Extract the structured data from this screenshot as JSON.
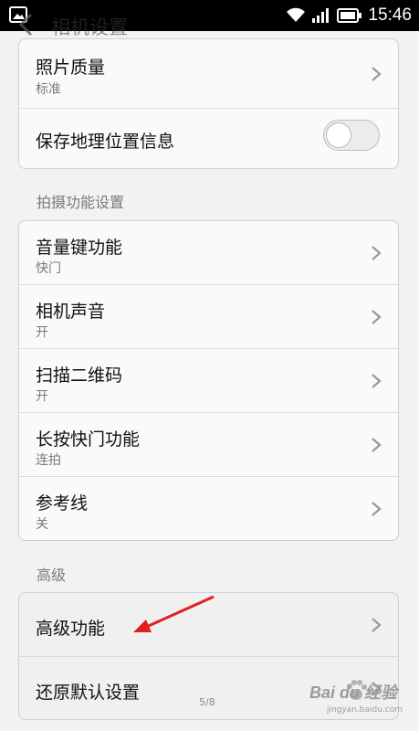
{
  "status_bar": {
    "time": "15:46"
  },
  "header": {
    "title": "相机设置"
  },
  "group_general": {
    "items": [
      {
        "label": "照片质量",
        "value": "标准"
      },
      {
        "label": "保存地理位置信息",
        "toggle": false
      }
    ]
  },
  "section_shooting": {
    "title": "拍摄功能设置"
  },
  "group_shooting": {
    "items": [
      {
        "label": "音量键功能",
        "value": "快门"
      },
      {
        "label": "相机声音",
        "value": "开"
      },
      {
        "label": "扫描二维码",
        "value": "开"
      },
      {
        "label": "长按快门功能",
        "value": "连拍"
      },
      {
        "label": "参考线",
        "value": "关"
      }
    ]
  },
  "section_advanced": {
    "title": "高级"
  },
  "group_advanced": {
    "items": [
      {
        "label": "高级功能"
      },
      {
        "label": "还原默认设置"
      }
    ]
  },
  "footer": {
    "page_indicator": "5/8"
  },
  "watermark": {
    "brand": "Bai du 经验",
    "url": "jingyan.baidu.com"
  },
  "colors": {
    "annotation_arrow": "#e02020",
    "status_bar": "#000000"
  }
}
